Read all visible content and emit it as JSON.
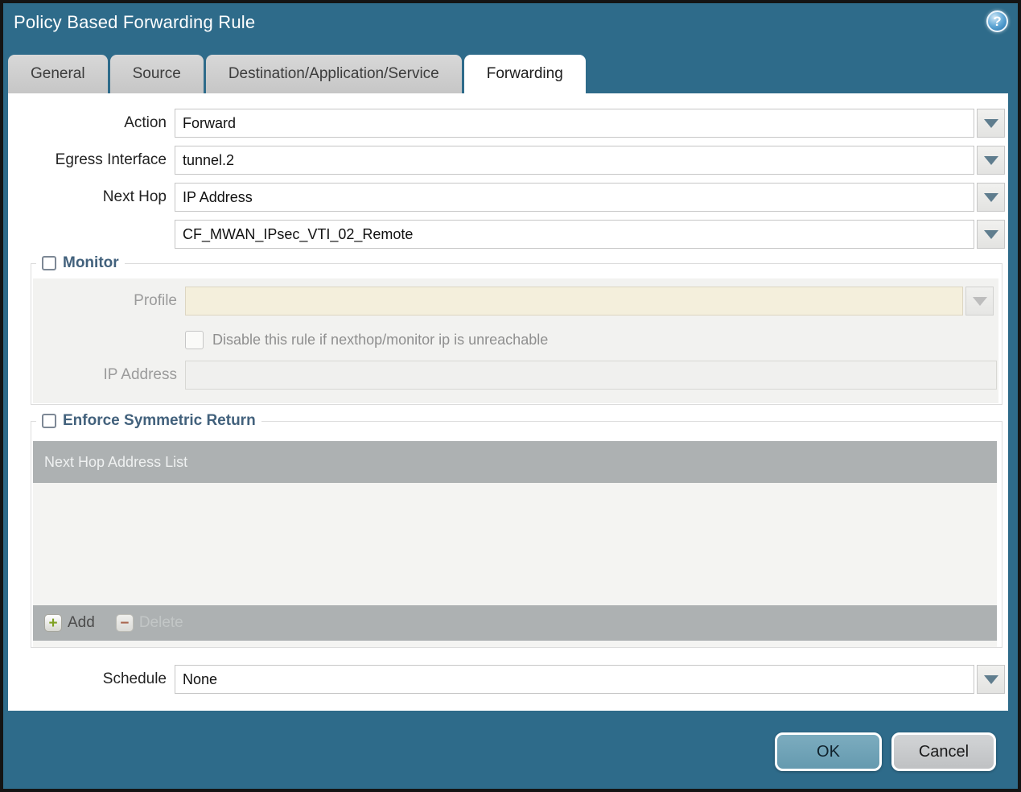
{
  "window": {
    "title": "Policy Based Forwarding Rule"
  },
  "icons": {
    "help": "?",
    "add": "+",
    "delete": "−"
  },
  "tabs": [
    {
      "label": "General",
      "active": false
    },
    {
      "label": "Source",
      "active": false
    },
    {
      "label": "Destination/Application/Service",
      "active": false
    },
    {
      "label": "Forwarding",
      "active": true
    }
  ],
  "form": {
    "action_label": "Action",
    "action_value": "Forward",
    "egress_label": "Egress Interface",
    "egress_value": "tunnel.2",
    "next_hop_label": "Next Hop",
    "next_hop_value": "IP Address",
    "next_hop_address_value": "CF_MWAN_IPsec_VTI_02_Remote",
    "schedule_label": "Schedule",
    "schedule_value": "None"
  },
  "monitor": {
    "title": "Monitor",
    "checked": false,
    "profile_label": "Profile",
    "profile_value": "",
    "disable_label": "Disable this rule if nexthop/monitor ip is unreachable",
    "disable_checked": false,
    "ip_label": "IP Address",
    "ip_value": ""
  },
  "symmetric": {
    "title": "Enforce Symmetric Return",
    "checked": false,
    "table_header": "Next Hop Address List",
    "add_label": "Add",
    "delete_label": "Delete"
  },
  "buttons": {
    "ok": "OK",
    "cancel": "Cancel"
  },
  "colors": {
    "titlebar": "#2e6b8a",
    "ok_button": "#70a3b8",
    "cancel_button": "#c9cbcd",
    "legend_text": "#42617c",
    "table_gray": "#adb1b2",
    "profile_field": "#f4efdc"
  }
}
